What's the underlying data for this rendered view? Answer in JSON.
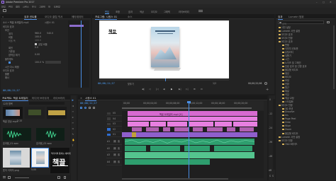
{
  "window": {
    "title": "Adobe Premiere Pro 2017",
    "menu": [
      "파일",
      "편집",
      "클립",
      "시퀀스",
      "표식",
      "그래픽",
      "창",
      "도움말"
    ],
    "controls": {
      "minimize": "–",
      "maximize": "□",
      "close": "✕"
    }
  },
  "workspaces": {
    "items": [
      "편집",
      "조합",
      "효과",
      "색상",
      "오디오",
      "그래픽",
      "라이브러리"
    ],
    "active_index": 0
  },
  "effect_controls": {
    "tabs": [
      "효과 컨트롤",
      "오디오 클립 믹서",
      "메타데이터"
    ],
    "source_label": "소스 • 책끌 트레일러.mp4",
    "sequence_label": "시퀀스 01",
    "sections": [
      "비디오 효과",
      "모션",
      "위치",
      "비율",
      "비율 폭",
      "균일 비율",
      "회전",
      "기준점",
      "깜박임 제거",
      "불투명도",
      "시간 다시 매핑",
      "오디오 효과",
      "볼륨",
      "패너"
    ],
    "values": [
      "960.0",
      "540.0",
      "100.0",
      "100.0",
      "0.0",
      "0.00",
      "100.0 %"
    ],
    "checkbox_label": "균일 비율",
    "timecode": "00;00;11;17"
  },
  "program_monitor": {
    "tabs": [
      "프로그램: 시퀀스 01",
      "소스"
    ],
    "brand_text": "책끌",
    "timecode_left": "00;00;11;17",
    "fit_label": "맞추기",
    "quality_label": "1/2",
    "timecode_right": "00;00;22;06",
    "transport": [
      "◀|",
      "◁",
      "|◁",
      "◀",
      "▶",
      "▶|",
      "▷|",
      "⊞",
      "⊡"
    ],
    "book_stripes": [
      "#6aa9d8",
      "#cfd8e0",
      "#8fb7cf",
      "#e7c9c2",
      "#96b3c6"
    ]
  },
  "effects_panel": {
    "tabs": [
      "효과",
      "Lumetri 범위"
    ],
    "search_placeholder": "검색",
    "items": [
      "사전 설정",
      "Lumetri 사전 설정",
      "오디오 효과",
      "오디오 전환",
      "비디오 효과",
      "변형",
      "이미지 컨트롤",
      "유틸리티",
      "뒤틀기",
      "시간",
      "노이즈 및 그레인",
      "흐림 효과 및 선명 효과",
      "몰입형 비디오",
      "생성",
      "비디오",
      "조정",
      "전환",
      "원근",
      "채널",
      "키잉",
      "색상 교정",
      "스타일화",
      "비디오 전환",
      "3D 모션",
      "Dissolve",
      "Iris",
      "Page Peel",
      "Slide",
      "Wipe",
      "Zoom",
      "몰입형 비디오",
      "Lumetri 사전 설정",
      "오디오 전환",
      "크로스페이드"
    ]
  },
  "project_panel": {
    "tabs": [
      "프로젝트: 책끌 트레일러",
      "미디어 브라우저",
      "라이브러리"
    ],
    "item_count": "12개 항목",
    "bins": [
      {
        "name": "책끌 영상.mp4",
        "duration": "2;15"
      },
      {
        "name": "효과음_01.wav",
        "duration": "1;02"
      },
      {
        "name": "효과음_02.wav",
        "duration": "0;18"
      },
      {
        "name": "표지 이미지.png",
        "duration": "5;00"
      },
      {
        "name": "책끌 로고",
        "duration": "5;00"
      }
    ],
    "logo_caption": "책거리의 풍미는 새하게",
    "logo_text": "책끌"
  },
  "tools": [
    "▸",
    "⇉",
    "⇿",
    "⧖",
    "✂",
    "⇔",
    "✎",
    "✋",
    "T"
  ],
  "timeline": {
    "tab": "시퀀스 01",
    "timecode": "00;00;11;17",
    "ruler": [
      "00;00",
      "00;00;04;00",
      "00;00;08;00",
      "00;00;12;00",
      "00;00;16;00",
      "00;00;20;00",
      "00;00;24;00"
    ],
    "video_tracks": [
      "V5",
      "V4",
      "V3",
      "V2",
      "V1"
    ],
    "audio_tracks": [
      "A1",
      "A2",
      "A3",
      "A4"
    ],
    "track_buttons": [
      "M",
      "S"
    ],
    "clip_label": "책끌 트레일러.mp4 [V]",
    "colors": {
      "video": "#e77fe0",
      "video_dark": "#b05fb0",
      "audio": "#2e9e6e",
      "audio_light": "#54c48e",
      "gold": "#c2a03a",
      "blue": "#4a84c9"
    }
  },
  "audio_meter": {
    "db_labels": [
      "0",
      "-12",
      "-24",
      "-36",
      "-48",
      "dB"
    ],
    "channels": [
      "S",
      "S"
    ]
  }
}
